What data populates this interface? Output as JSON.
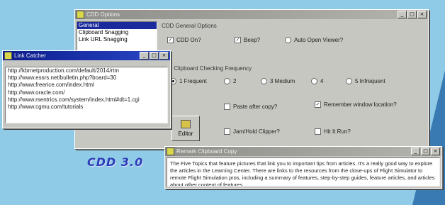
{
  "main_window": {
    "title": "CDD Options",
    "sidebar_items": [
      "General",
      "Clipboard Snagging",
      "Link URL Snagging"
    ],
    "general_options": {
      "heading": "CDD General Options",
      "on_top_label": "CDD On?",
      "on_top_checked": true,
      "beep_label": "Beep?",
      "beep_checked": true,
      "auto_open_label": "Auto Open Viewer?",
      "auto_open_checked": false
    },
    "frequency": {
      "heading": "Pick Clipboard Checking Frequency",
      "options": [
        "1 Frequent",
        "2",
        "3 Medium",
        "4",
        "5 Infrequent"
      ],
      "selected": 0
    },
    "checkboxes": {
      "paste_label": "Paste after copy?",
      "paste_checked": false,
      "remember_label": "Remember window location?",
      "remember_checked": true,
      "sound_label": "Jam/Hold Clipper?",
      "sound_checked": false,
      "hitit_label": "Hit It Run?",
      "hitit_checked": false
    },
    "editor_button": "Editor",
    "logo_text": "CDD 3.0"
  },
  "links_window": {
    "title": "Link Catcher",
    "links": [
      "http://kbrnetproduction.com/default/2014/rtm",
      "http://www.essrs.net/bulletin.php?board=30",
      "http://www.freerice.com/index.html",
      "http://www.oracle.com/",
      "http://www.rsentrics.com/system/index.html#dt=1.cgi",
      "http://www.cgmu.com/tutorials"
    ]
  },
  "clip_window": {
    "title": "Remark Clipboard Copy",
    "text": "The Five Topics that feature pictures that link you to important tips from articles. It's a really good way to explore the articles in the Learning Center. There are links to the resources from the close-ups of Flight Simulator to remote Flight Simulation pros, including a summary of features, step-by-step guides, feature articles, and articles about other content of features."
  }
}
